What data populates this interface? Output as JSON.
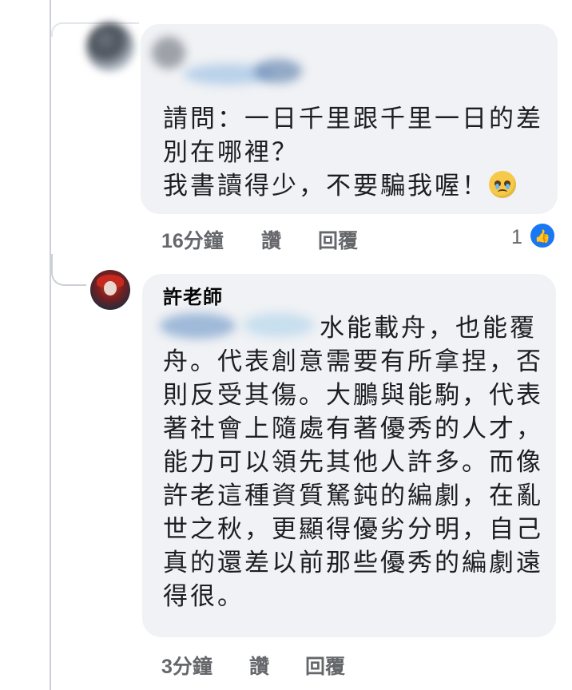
{
  "comments": [
    {
      "author": "",
      "lines": [
        "請問：一日千里跟千里一日的差",
        "別在哪裡？",
        "我書讀得少，不要騙我喔！"
      ],
      "emoji": "pleading-face",
      "time": "16分鐘",
      "like_label": "讚",
      "reply_label": "回覆",
      "reaction_count": "1"
    },
    {
      "author": "許老師",
      "lines": [
        "水能載舟，也能覆",
        "舟。代表創意需要有所拿捏，否",
        "則反受其傷。大鵬與能駒，代表",
        "著社會上隨處有著優秀的人才，",
        "能力可以領先其他人許多。而像",
        "許老這種資質駑鈍的編劇，在亂",
        "世之秋，更顯得優劣分明，自己",
        "真的還差以前那些優秀的編劇遠",
        "得很。"
      ],
      "time": "3分鐘",
      "like_label": "讚",
      "reply_label": "回覆"
    }
  ],
  "colors": {
    "bubble": "#f0f2f5",
    "meta_text": "#65676b",
    "like_blue": "#1877f2",
    "thread_line": "#ccd0d5"
  },
  "icons": {
    "like": "thumbs-up-icon",
    "emoji": "pleading-face-emoji"
  }
}
